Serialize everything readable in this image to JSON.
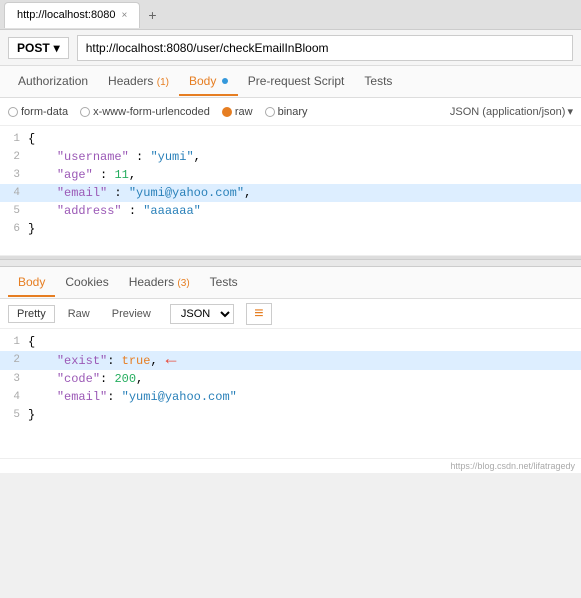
{
  "browser": {
    "tab_label": "http://localhost:8080",
    "tab_close": "×",
    "tab_new": "+"
  },
  "address": {
    "method": "POST",
    "method_chevron": "▾",
    "url": "http://localhost:8080/user/checkEmailInBloom"
  },
  "request": {
    "tabs": [
      {
        "label": "Authorization",
        "active": false,
        "badge": ""
      },
      {
        "label": "Headers",
        "active": false,
        "badge": "(1)"
      },
      {
        "label": "Body",
        "active": true,
        "badge": ""
      },
      {
        "label": "Pre-request Script",
        "active": false,
        "badge": ""
      },
      {
        "label": "Tests",
        "active": false,
        "badge": ""
      }
    ],
    "body_options": [
      {
        "label": "form-data",
        "selected": false
      },
      {
        "label": "x-www-form-urlencoded",
        "selected": false
      },
      {
        "label": "raw",
        "selected": true
      },
      {
        "label": "binary",
        "selected": false
      }
    ],
    "json_format": "JSON (application/json)",
    "code_lines": [
      {
        "num": "1",
        "content": "{",
        "highlighted": false
      },
      {
        "num": "2",
        "content": "    \"username\" : \"yumi\",",
        "highlighted": false
      },
      {
        "num": "3",
        "content": "    \"age\" : 11,",
        "highlighted": false
      },
      {
        "num": "4",
        "content": "    \"email\" : \"yumi@yahoo.com\",",
        "highlighted": true
      },
      {
        "num": "5",
        "content": "    \"address\" : \"aaaaaa\"",
        "highlighted": false
      },
      {
        "num": "6",
        "content": "}",
        "highlighted": false
      }
    ]
  },
  "response": {
    "tabs": [
      {
        "label": "Body",
        "active": true
      },
      {
        "label": "Cookies",
        "active": false
      },
      {
        "label": "Headers",
        "active": false,
        "badge": "(3)"
      },
      {
        "label": "Tests",
        "active": false
      }
    ],
    "format_buttons": [
      {
        "label": "Pretty",
        "active": true
      },
      {
        "label": "Raw",
        "active": false
      },
      {
        "label": "Preview",
        "active": false
      }
    ],
    "json_select": "JSON",
    "wrap_icon": "≡",
    "code_lines": [
      {
        "num": "1",
        "content": "{",
        "highlighted": false
      },
      {
        "num": "2",
        "content": "    \"exist\": true,",
        "highlighted": true,
        "has_arrow": true
      },
      {
        "num": "3",
        "content": "    \"code\": 200,",
        "highlighted": false
      },
      {
        "num": "4",
        "content": "    \"email\": \"yumi@yahoo.com\"",
        "highlighted": false
      },
      {
        "num": "5",
        "content": "}",
        "highlighted": false
      }
    ],
    "watermark": "https://blog.csdn.net/lifatragedy"
  }
}
